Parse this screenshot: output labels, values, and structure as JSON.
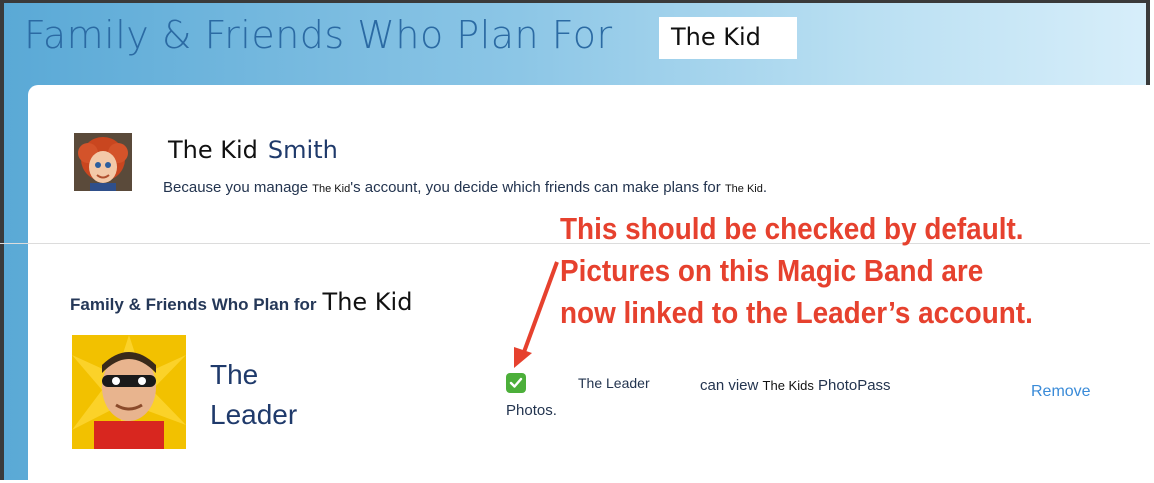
{
  "header": {
    "title": "Family & Friends Who Plan For",
    "kid_name": "The Kid"
  },
  "profile": {
    "first_name": "The Kid",
    "last_name": "Smith",
    "manage_prefix": "Because you manage",
    "manage_kid": "The Kid",
    "manage_middle": "'s account, you decide which friends can make plans for",
    "manage_kid2": "The Kid",
    "manage_suffix": "."
  },
  "section": {
    "title": "Family & Friends Who Plan for",
    "kid_name": "The Kid"
  },
  "friend": {
    "name": "The Leader",
    "permission_checked": true,
    "permission_name": "The Leader",
    "permission_can_view": "can view",
    "permission_kid": "The Kids",
    "permission_photopass": "PhotoPass",
    "permission_photos": "Photos.",
    "remove_label": "Remove"
  },
  "annotation": {
    "line1": "This should be checked by default.",
    "line2": "Pictures on this Magic Band are",
    "line3": "now linked to the Leader’s account.",
    "color": "#e6412e"
  },
  "colors": {
    "brand_blue": "#2b6aa3",
    "link_blue": "#3a8bd8",
    "check_green": "#4caf3a"
  }
}
